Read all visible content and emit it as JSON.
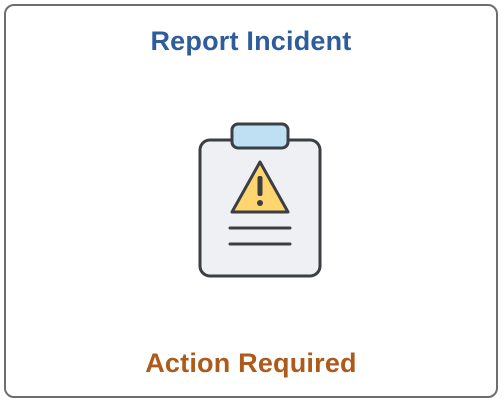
{
  "tile": {
    "title": "Report Incident",
    "status": "Action Required",
    "icon": "clipboard-warning-icon"
  },
  "colors": {
    "title": "#2f5d9c",
    "status": "#ad5a1c",
    "border": "#6e6e6e",
    "clip": "#bfe0f3",
    "warning": "#ffd56f"
  }
}
